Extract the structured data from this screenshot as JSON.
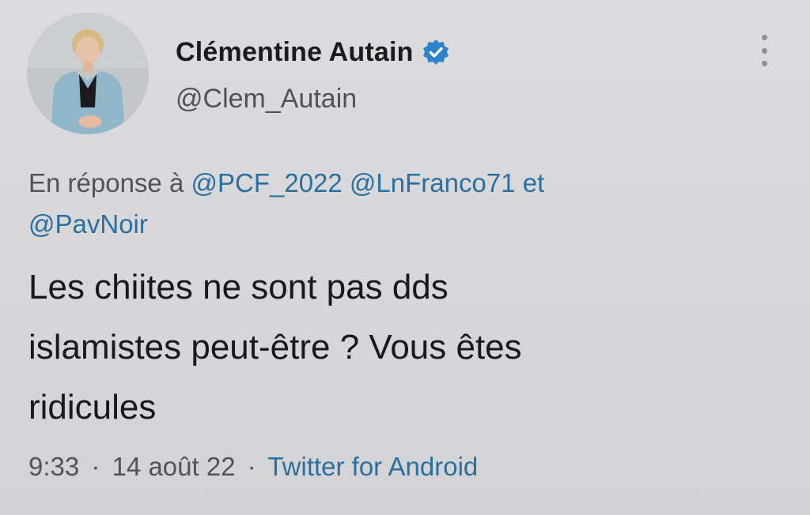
{
  "author": {
    "display_name": "Clémentine Autain",
    "handle": "@Clem_Autain",
    "verified_icon": "verified-badge-icon"
  },
  "menu": {
    "icon": "more-vertical-icon"
  },
  "reply_context": {
    "prefix": "En réponse à",
    "mentions": [
      "@PCF_2022",
      "@LnFranco71",
      "@PavNoir"
    ],
    "conjunction": "et"
  },
  "tweet": {
    "text": "Les chiites ne sont pas dds\nislamistes peut-être ? Vous êtes\nridicules"
  },
  "meta": {
    "time": "9:33",
    "separator": "·",
    "date": "14 août 22",
    "source": "Twitter for Android"
  },
  "colors": {
    "background": "#d8d8da",
    "link": "#2b6f9f",
    "verified": "#2b83c9"
  }
}
